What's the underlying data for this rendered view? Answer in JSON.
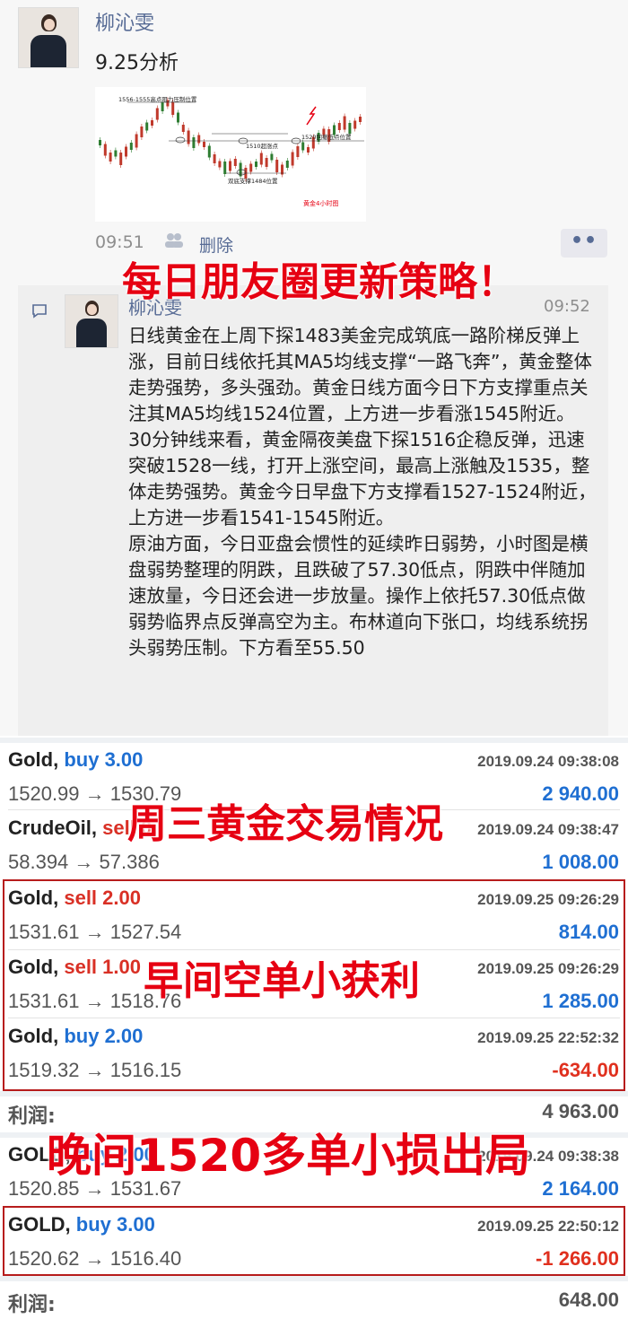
{
  "post": {
    "author": "柳沁雯",
    "title": "9.25分析",
    "time": "09:51",
    "delete_label": "删除",
    "more_label": "••",
    "image": {
      "annotations": [
        "1556-1555高点阻力压制位置",
        "1520回撤低点位置",
        "1510超涨点",
        "双底支撑1484位置",
        "黄金4小时图"
      ]
    }
  },
  "overlays": {
    "banner1": "每日朋友圈更新策略！",
    "banner2": "周三黄金交易情况",
    "banner3": "早间空单小获利",
    "banner4": "晚间1520多单小损出局"
  },
  "comment": {
    "author": "柳沁雯",
    "time": "09:52",
    "paragraphs": [
      "日线黄金在上周下探1483美金完成筑底一路阶梯反弹上涨，目前日线依托其MA5均线支撑“一路飞奔”，黄金整体走势强势，多头强劲。黄金日线方面今日下方支撑重点关注其MA5均线1524位置，上方进一步看涨1545附近。",
      "30分钟线来看，黄金隔夜美盘下探1516企稳反弹，迅速突破1528一线，打开上涨空间，最高上涨触及1535，整体走势强势。黄金今日早盘下方支撑看1527-1524附近，上方进一步看1541-1545附近。",
      "原油方面，今日亚盘会惯性的延续昨日弱势，小时图是横盘弱势整理的阴跌，且跌破了57.30低点，阴跌中伴随加速放量，今日还会进一步放量。操作上依托57.30低点做弱势临界点反弹高空为主。布林道向下张口，均线系统拐头弱势压制。下方看至55.50"
    ]
  },
  "trades": {
    "rows": [
      {
        "symbol": "Gold,",
        "side": "buy 3.00",
        "date": "2019.09.24 09:38:08",
        "prices": "1520.99 → 1530.79",
        "profit": "2 940.00"
      },
      {
        "symbol": "CrudeOil,",
        "side": "sell 0.",
        "date": "2019.09.24 09:38:47",
        "prices": "58.394 → 57.386",
        "profit": "1 008.00"
      },
      {
        "symbol": "Gold,",
        "side": "sell 2.00",
        "date": "2019.09.25 09:26:29",
        "prices": "1531.61 → 1527.54",
        "profit": "814.00"
      },
      {
        "symbol": "Gold,",
        "side": "sell 1.00",
        "date": "2019.09.25 09:26:29",
        "prices": "1531.61 → 1518.76",
        "profit": "1 285.00"
      },
      {
        "symbol": "Gold,",
        "side": "buy 2.00",
        "date": "2019.09.25 22:52:32",
        "prices": "1519.32 → 1516.15",
        "profit": "-634.00"
      }
    ],
    "summary1_label": "利润:",
    "summary1_value": "4 963.00",
    "rows2": [
      {
        "symbol": "GOLD,",
        "side": "buy 2.00",
        "date": "2019.09.24 09:38:38",
        "prices": "1520.85 → 1531.67",
        "profit": "2 164.00"
      },
      {
        "symbol": "GOLD,",
        "side": "buy 3.00",
        "date": "2019.09.25 22:50:12",
        "prices": "1520.62 → 1516.40",
        "profit": "-1 266.00"
      }
    ],
    "summary2_label": "利润:",
    "summary2_value": "648.00"
  }
}
